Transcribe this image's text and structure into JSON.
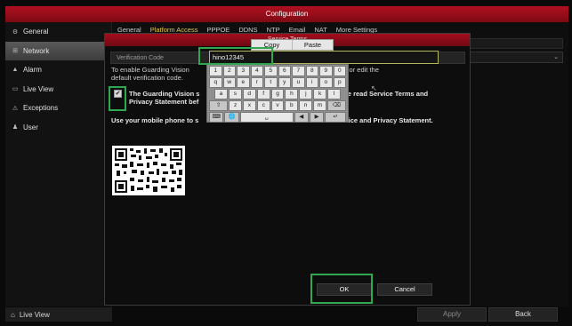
{
  "window": {
    "title": "Configuration"
  },
  "sidebar": {
    "items": [
      {
        "label": "General",
        "icon": "gear-icon",
        "glyph": "⚙"
      },
      {
        "label": "Network",
        "icon": "network-icon",
        "glyph": "⊞"
      },
      {
        "label": "Alarm",
        "icon": "alarm-icon",
        "glyph": "▲"
      },
      {
        "label": "Live View",
        "icon": "live-view-icon",
        "glyph": "▭"
      },
      {
        "label": "Exceptions",
        "icon": "warning-icon",
        "glyph": "⚠"
      },
      {
        "label": "User",
        "icon": "user-icon",
        "glyph": "♟"
      }
    ],
    "bottom_label": "Live View",
    "bottom_icon": "home-icon"
  },
  "tabs": [
    "General",
    "Platform Access",
    "PPPOE",
    "DDNS",
    "NTP",
    "Email",
    "NAT",
    "More Settings"
  ],
  "footer": {
    "apply_label": "Apply",
    "back_label": "Back"
  },
  "dialog": {
    "title": "Service Terms",
    "verification_label": "Verification Code",
    "desc1_line1": "To enable Guarding Vision",
    "desc1_line1b": "ation code or edit the",
    "desc1_line2": "default verification code.",
    "terms_line1": "The Guarding Vision s",
    "terms_line1b": "ase read Service Terms and",
    "terms_line2": "Privacy Statement bef",
    "scan_line": "Use your mobile phone to s",
    "scan_line_b": "ervice and Privacy Statement.",
    "ok_label": "OK",
    "cancel_label": "Cancel",
    "checkbox_glyph": "✔"
  },
  "context_menu": {
    "copy_label": "Copy",
    "paste_label": "Paste"
  },
  "input": {
    "value": "hino12345"
  },
  "keyboard": {
    "row1": [
      "1",
      "2",
      "3",
      "4",
      "5",
      "6",
      "7",
      "8",
      "9",
      "0"
    ],
    "row2": [
      "q",
      "w",
      "e",
      "r",
      "t",
      "y",
      "u",
      "i",
      "o",
      "p"
    ],
    "row3": [
      "a",
      "s",
      "d",
      "f",
      "g",
      "h",
      "j",
      "k",
      "l"
    ],
    "row4": [
      "⇧",
      "z",
      "x",
      "c",
      "v",
      "b",
      "n",
      "m",
      "⌫"
    ],
    "row5": [
      "⌨",
      "🌐",
      "␣",
      "◀",
      "▶",
      "↵"
    ]
  },
  "colors": {
    "highlight": "#2fa84f",
    "accent_red": "#b01020",
    "active_tab": "#e8c84a"
  }
}
